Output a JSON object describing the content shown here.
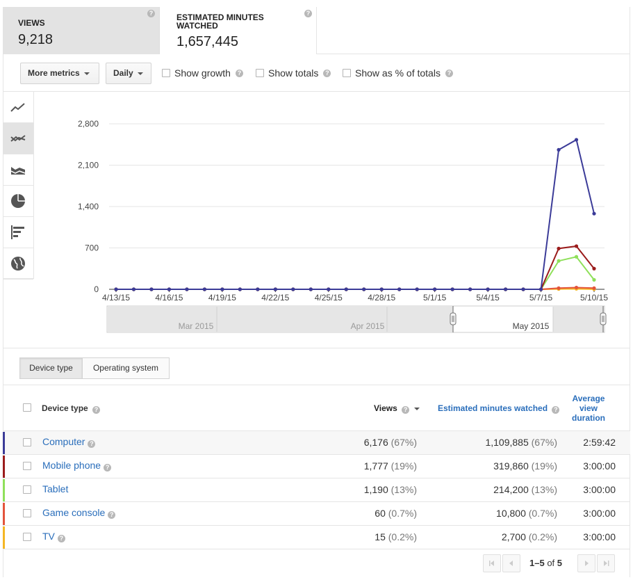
{
  "cards": [
    {
      "title": "VIEWS",
      "value": "9,218"
    },
    {
      "title": "ESTIMATED MINUTES WATCHED",
      "value": "1,657,445"
    }
  ],
  "toolbar": {
    "more_metrics": "More metrics",
    "period": "Daily",
    "show_growth": "Show growth",
    "show_totals": "Show totals",
    "show_pct": "Show as % of totals"
  },
  "chart_data": {
    "type": "line",
    "x": [
      "4/13/15",
      "4/14/15",
      "4/15/15",
      "4/16/15",
      "4/17/15",
      "4/18/15",
      "4/19/15",
      "4/20/15",
      "4/21/15",
      "4/22/15",
      "4/23/15",
      "4/24/15",
      "4/25/15",
      "4/26/15",
      "4/27/15",
      "4/28/15",
      "4/29/15",
      "4/30/15",
      "5/1/15",
      "5/2/15",
      "5/3/15",
      "5/4/15",
      "5/5/15",
      "5/6/15",
      "5/7/15",
      "5/8/15",
      "5/9/15",
      "5/10/15"
    ],
    "x_tick_labels": [
      "4/13/15",
      "4/16/15",
      "4/19/15",
      "4/22/15",
      "4/25/15",
      "4/28/15",
      "5/1/15",
      "5/4/15",
      "5/7/15",
      "5/10/15"
    ],
    "y_ticks": [
      "0",
      "700",
      "1,400",
      "2,100",
      "2,800"
    ],
    "ylim": [
      0,
      2800
    ],
    "series": [
      {
        "name": "Computer",
        "color": "#3b3b98",
        "values": [
          0,
          0,
          0,
          0,
          0,
          0,
          0,
          0,
          0,
          0,
          0,
          0,
          0,
          0,
          0,
          0,
          0,
          0,
          0,
          0,
          0,
          0,
          0,
          0,
          0,
          2360,
          2530,
          1280
        ]
      },
      {
        "name": "Mobile phone",
        "color": "#9b1c1c",
        "values": [
          0,
          0,
          0,
          0,
          0,
          0,
          0,
          0,
          0,
          0,
          0,
          0,
          0,
          0,
          0,
          0,
          0,
          0,
          0,
          0,
          0,
          0,
          0,
          0,
          0,
          690,
          730,
          350
        ]
      },
      {
        "name": "Tablet",
        "color": "#8fe05a",
        "values": [
          0,
          0,
          0,
          0,
          0,
          0,
          0,
          0,
          0,
          0,
          0,
          0,
          0,
          0,
          0,
          0,
          0,
          0,
          0,
          0,
          0,
          0,
          0,
          0,
          0,
          480,
          550,
          160
        ]
      },
      {
        "name": "Game console",
        "color": "#e3543b",
        "values": [
          0,
          0,
          0,
          0,
          0,
          0,
          0,
          0,
          0,
          0,
          0,
          0,
          0,
          0,
          0,
          0,
          0,
          0,
          0,
          0,
          0,
          0,
          0,
          0,
          0,
          20,
          30,
          20
        ]
      },
      {
        "name": "TV",
        "color": "#f5b623",
        "values": [
          0,
          0,
          0,
          0,
          0,
          0,
          0,
          0,
          0,
          0,
          0,
          0,
          0,
          0,
          0,
          0,
          0,
          0,
          0,
          0,
          0,
          0,
          0,
          0,
          0,
          5,
          8,
          2
        ]
      }
    ],
    "range_labels": [
      "Mar 2015",
      "Apr 2015",
      "May 2015"
    ]
  },
  "tabs": [
    "Device type",
    "Operating system"
  ],
  "table": {
    "headers": {
      "name": "Device type",
      "views": "Views",
      "minutes": "Estimated minutes watched",
      "avg": [
        "Average",
        "view",
        "duration"
      ]
    },
    "rows": [
      {
        "name": "Computer",
        "color": "#3b3b98",
        "views": "6,176",
        "views_pct": "(67%)",
        "minutes": "1,109,885",
        "minutes_pct": "(67%)",
        "avg": "2:59:42"
      },
      {
        "name": "Mobile phone",
        "color": "#9b1c1c",
        "views": "1,777",
        "views_pct": "(19%)",
        "minutes": "319,860",
        "minutes_pct": "(19%)",
        "avg": "3:00:00"
      },
      {
        "name": "Tablet",
        "color": "#8fe05a",
        "views": "1,190",
        "views_pct": "(13%)",
        "minutes": "214,200",
        "minutes_pct": "(13%)",
        "avg": "3:00:00"
      },
      {
        "name": "Game console",
        "color": "#e3543b",
        "views": "60",
        "views_pct": "(0.7%)",
        "minutes": "10,800",
        "minutes_pct": "(0.7%)",
        "avg": "3:00:00"
      },
      {
        "name": "TV",
        "color": "#f5b623",
        "views": "15",
        "views_pct": "(0.2%)",
        "minutes": "2,700",
        "minutes_pct": "(0.2%)",
        "avg": "3:00:00"
      }
    ]
  },
  "pager": {
    "range": "1–5",
    "of": "of",
    "total": "5"
  }
}
